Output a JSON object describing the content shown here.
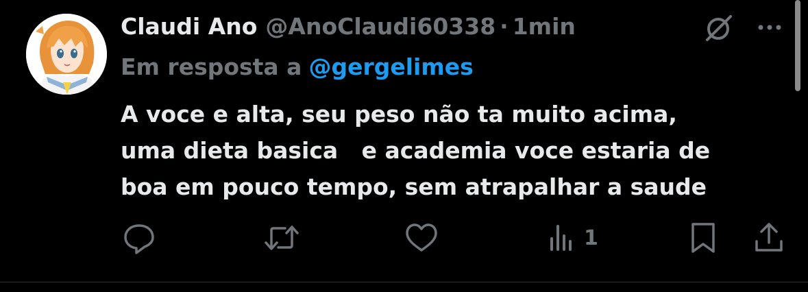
{
  "tweet": {
    "author_name": "Claudi Ano",
    "handle": "@AnoClaudi60338",
    "separator": "·",
    "time": "1min",
    "reply_prefix": "Em resposta a",
    "reply_mention": "@gergelimes",
    "body_lines": [
      "A voce e alta, seu peso não ta muito acima,",
      "uma dieta basica   e academia voce estaria de",
      "boa em pouco tempo, sem atrapalhar a saude"
    ],
    "views_count": "1"
  },
  "icons": {
    "avatar": "anime-avatar",
    "grok": "grok-icon",
    "more": "more-icon",
    "reply": "reply-icon",
    "repost": "repost-icon",
    "like": "like-icon",
    "views": "views-icon",
    "bookmark": "bookmark-icon",
    "share": "share-icon"
  },
  "colors": {
    "background": "#000000",
    "primary_text": "#e7e9ea",
    "secondary_text": "#71767b",
    "link": "#1d9bf0"
  }
}
